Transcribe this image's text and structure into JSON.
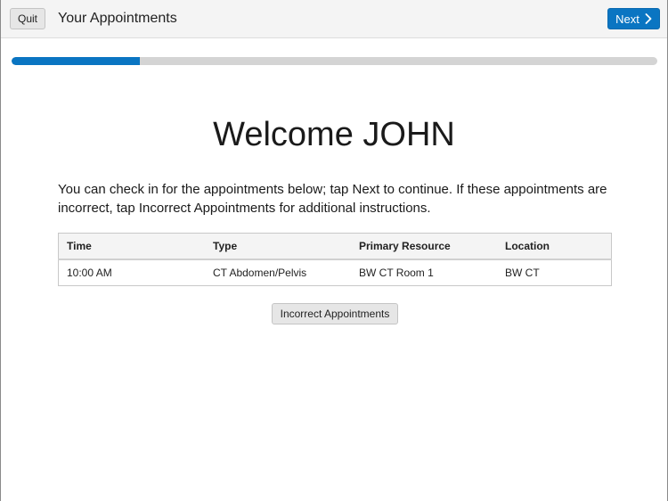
{
  "header": {
    "quit_label": "Quit",
    "title": "Your Appointments",
    "next_label": "Next"
  },
  "progress": {
    "fraction": 0.198,
    "fill_color": "#0a75c2",
    "track_color": "#d4d4d4"
  },
  "main": {
    "welcome": "Welcome JOHN",
    "instructions": "You can check in for the appointments below; tap Next to continue. If these appointments are incorrect, tap Incorrect Appointments for additional instructions.",
    "table": {
      "columns": [
        "Time",
        "Type",
        "Primary Resource",
        "Location"
      ],
      "rows": [
        [
          "10:00 AM",
          "CT Abdomen/Pelvis",
          "BW CT Room 1",
          "BW CT"
        ]
      ]
    },
    "incorrect_label": "Incorrect Appointments"
  },
  "colors": {
    "accent": "#0a75c2",
    "header_bg": "#f4f4f4"
  },
  "icons": {
    "next": "chevron-right-icon"
  }
}
